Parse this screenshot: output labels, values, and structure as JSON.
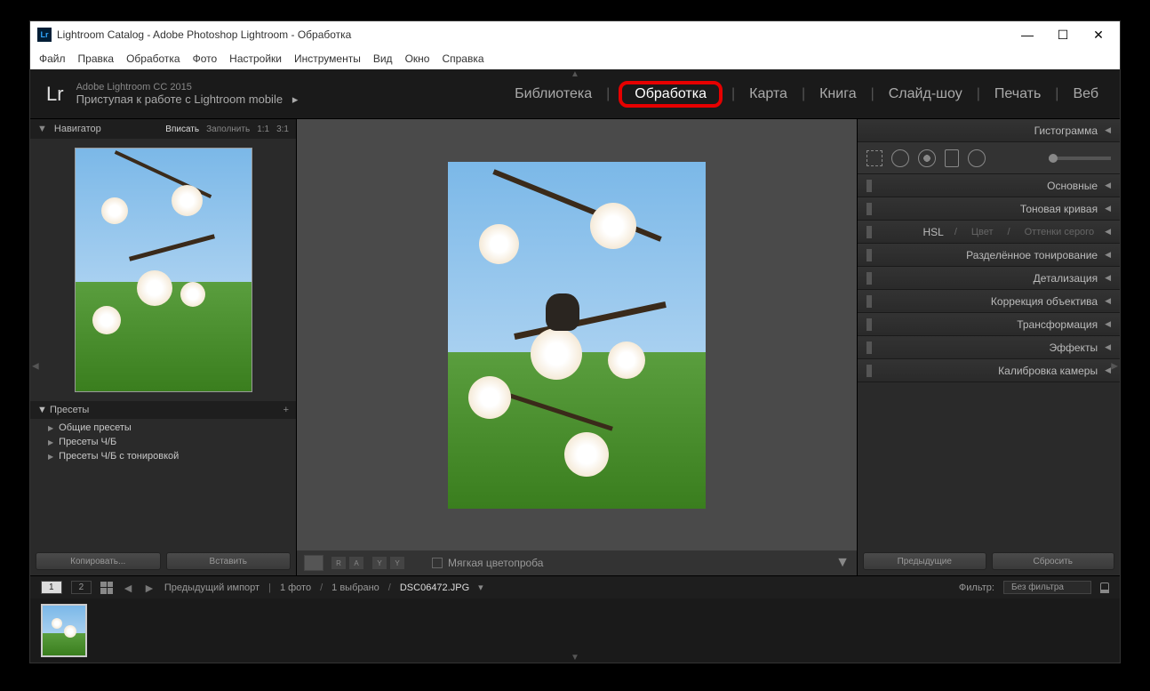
{
  "titlebar": {
    "icon": "Lr",
    "text": "Lightroom Catalog - Adobe Photoshop Lightroom - Обработка"
  },
  "menubar": [
    "Файл",
    "Правка",
    "Обработка",
    "Фото",
    "Настройки",
    "Инструменты",
    "Вид",
    "Окно",
    "Справка"
  ],
  "header": {
    "logo": "Lr",
    "line1": "Adobe Lightroom CC 2015",
    "line2_a": "Приступая к работе с ",
    "line2_b": "Lightroom mobile",
    "modules": [
      "Библиотека",
      "Обработка",
      "Карта",
      "Книга",
      "Слайд-шоу",
      "Печать",
      "Веб"
    ],
    "active_module": "Обработка"
  },
  "navigator": {
    "title": "Навигатор",
    "zoom": [
      "Вписать",
      "Заполнить",
      "1:1",
      "3:1"
    ],
    "active_zoom": "Вписать"
  },
  "presets": {
    "title": "Пресеты",
    "items": [
      "Общие пресеты",
      "Пресеты Ч/Б",
      "Пресеты Ч/Б с тонировкой"
    ]
  },
  "copy_paste": {
    "copy": "Копировать...",
    "paste": "Вставить"
  },
  "center_toolbar": {
    "softproof": "Мягкая цветопроба"
  },
  "right_panel": {
    "histogram": "Гистограмма",
    "sections": [
      "Основные",
      "Тоновая кривая"
    ],
    "hsl": {
      "a": "HSL",
      "b": "Цвет",
      "c": "Оттенки серого"
    },
    "sections2": [
      "Разделённое тонирование",
      "Детализация",
      "Коррекция объектива",
      "Трансформация",
      "Эффекты",
      "Калибровка камеры"
    ]
  },
  "prev_reset": {
    "prev": "Предыдущие",
    "reset": "Сбросить"
  },
  "bottom_bar": {
    "views": [
      "1",
      "2"
    ],
    "source": "Предыдущий импорт",
    "count": "1 фото",
    "selected": "1 выбрано",
    "filename": "DSC06472.JPG",
    "filter_label": "Фильтр:",
    "filter_value": "Без фильтра"
  }
}
